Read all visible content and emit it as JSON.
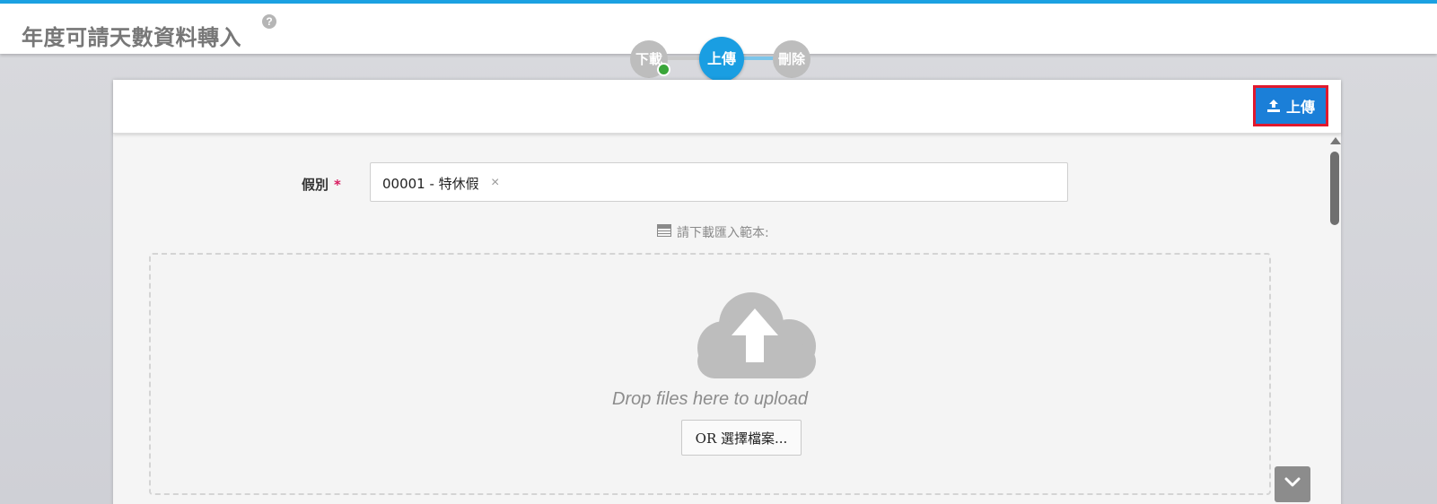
{
  "header": {
    "title": "年度可請天數資料轉入",
    "help_icon": "question-circle-icon"
  },
  "wizard": {
    "steps": [
      {
        "label": "下載",
        "state": "completed"
      },
      {
        "label": "上傳",
        "state": "active"
      },
      {
        "label": "刪除",
        "state": "pending"
      }
    ],
    "active_color": "#1a9ee2",
    "completed_color": "#3aa63a"
  },
  "toolbar": {
    "upload_label": "上傳",
    "upload_icon": "upload-icon",
    "upload_color": "#1b7fd8"
  },
  "form": {
    "leave_type_label": "假別",
    "required_mark": "*",
    "leave_type_value": "00001 - 特休假",
    "clear_symbol": "×"
  },
  "template": {
    "icon": "table-icon",
    "text": "請下載匯入範本:"
  },
  "dropzone": {
    "icon": "cloud-upload-icon",
    "text": "Drop files here to upload",
    "choose_button_label": "OR 選擇檔案..."
  },
  "scroll": {
    "down_icon": "chevron-down-icon"
  }
}
